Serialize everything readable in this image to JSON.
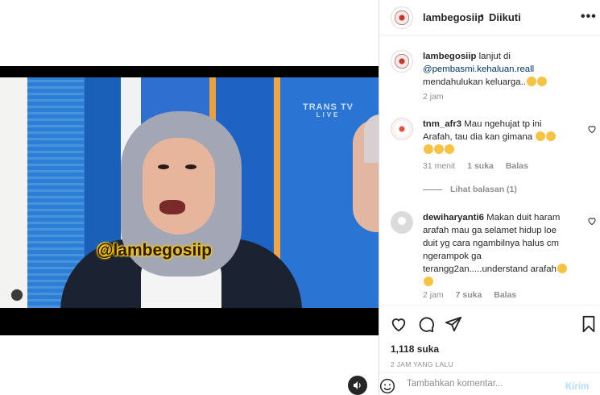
{
  "media": {
    "overlay_handle": "@lambegosiip",
    "tv_watermark": "TRANS TV",
    "tv_watermark_sub": "LIVE"
  },
  "header": {
    "username": "lambegosiip",
    "separator": "•",
    "follow_label": "Diikuti",
    "more_label": "•••"
  },
  "caption": {
    "username": "lambegosiip",
    "text_1": "lanjut di",
    "mention": "@pembasmi.kehaluan.reall",
    "text_2": "mendahulukan keluarga..",
    "time": "2 jam"
  },
  "comments": [
    {
      "username": "tnm_afr3",
      "text_1": "Mau ngehujat tp ini",
      "text_2": "Arafah, tau dia kan gimana",
      "time": "31 menit",
      "likes": "1 suka",
      "reply": "Balas"
    },
    {
      "username": "dewiharyanti6",
      "text_1": "Makan duit haram",
      "text_2": "arafah mau ga selamet hidup loe",
      "text_3": "duit yg cara ngambilnya halus cm",
      "text_4": "ngerampok ga",
      "text_5": "terangg2an.....understand arafah",
      "time": "2 jam",
      "likes": "7 suka",
      "reply": "Balas"
    }
  ],
  "view_replies": "Lihat balasan (1)",
  "likes_count": "1,118 suka",
  "post_time": "2 JAM YANG LALU",
  "composer": {
    "placeholder": "Tambahkan komentar...",
    "post_label": "Kirim"
  },
  "icons": {
    "like": "heart-icon",
    "comment": "comment-icon",
    "share": "share-icon",
    "save": "bookmark-icon",
    "emoji": "emoji-icon",
    "mute": "speaker-icon"
  },
  "colors": {
    "link": "#00376b",
    "muted": "#8e8e8e",
    "post_disabled": "#b2dffc",
    "overlay_text": "#f5c518"
  }
}
